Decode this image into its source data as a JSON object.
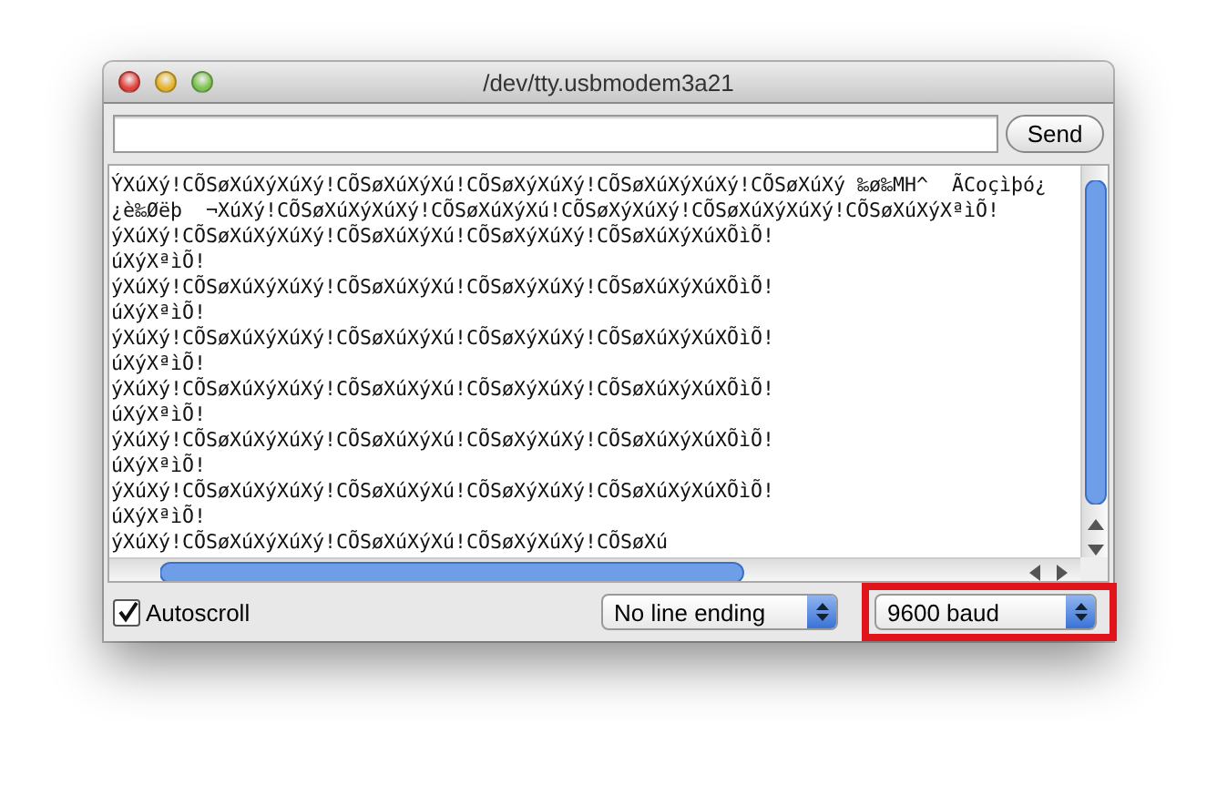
{
  "window": {
    "title": "/dev/tty.usbmodem3a21"
  },
  "send_button": {
    "label": "Send"
  },
  "console_lines": [
    "ÝXúXý!CÕSøXúXýXúXý!CÕSøXúXýXú!CÕSøXýXúXý!CÕSøXúXýXúXý!CÕSøXúXý ‰ø‰MH^  ÃCoçìþó¿",
    "¿è‰Øëþ  ¬XúXý!CÕSøXúXýXúXý!CÕSøXúXýXú!CÕSøXýXúXý!CÕSøXúXýXúXý!CÕSøXúXýXªìÕ!",
    "ýXúXý!CÕSøXúXýXúXý!CÕSøXúXýXú!CÕSøXýXúXý!CÕSøXúXýXúXÕìÕ!",
    "úXýXªìÕ!",
    "ýXúXý!CÕSøXúXýXúXý!CÕSøXúXýXú!CÕSøXýXúXý!CÕSøXúXýXúXÕìÕ!",
    "úXýXªìÕ!",
    "ýXúXý!CÕSøXúXýXúXý!CÕSøXúXýXú!CÕSøXýXúXý!CÕSøXúXýXúXÕìÕ!",
    "úXýXªìÕ!",
    "ýXúXý!CÕSøXúXýXúXý!CÕSøXúXýXú!CÕSøXýXúXý!CÕSøXúXýXúXÕìÕ!",
    "úXýXªìÕ!",
    "ýXúXý!CÕSøXúXýXúXý!CÕSøXúXýXú!CÕSøXýXúXý!CÕSøXúXýXúXÕìÕ!",
    "úXýXªìÕ!",
    "ýXúXý!CÕSøXúXýXúXý!CÕSøXúXýXú!CÕSøXýXúXý!CÕSøXúXýXúXÕìÕ!",
    "úXýXªìÕ!",
    "ýXúXý!CÕSøXúXýXúXý!CÕSøXúXýXú!CÕSøXýXúXý!CÕSøXú"
  ],
  "autoscroll": {
    "label": "Autoscroll",
    "checked": true
  },
  "line_ending_select": {
    "value": "No line ending"
  },
  "baud_select": {
    "value": "9600 baud",
    "highlighted": true
  }
}
